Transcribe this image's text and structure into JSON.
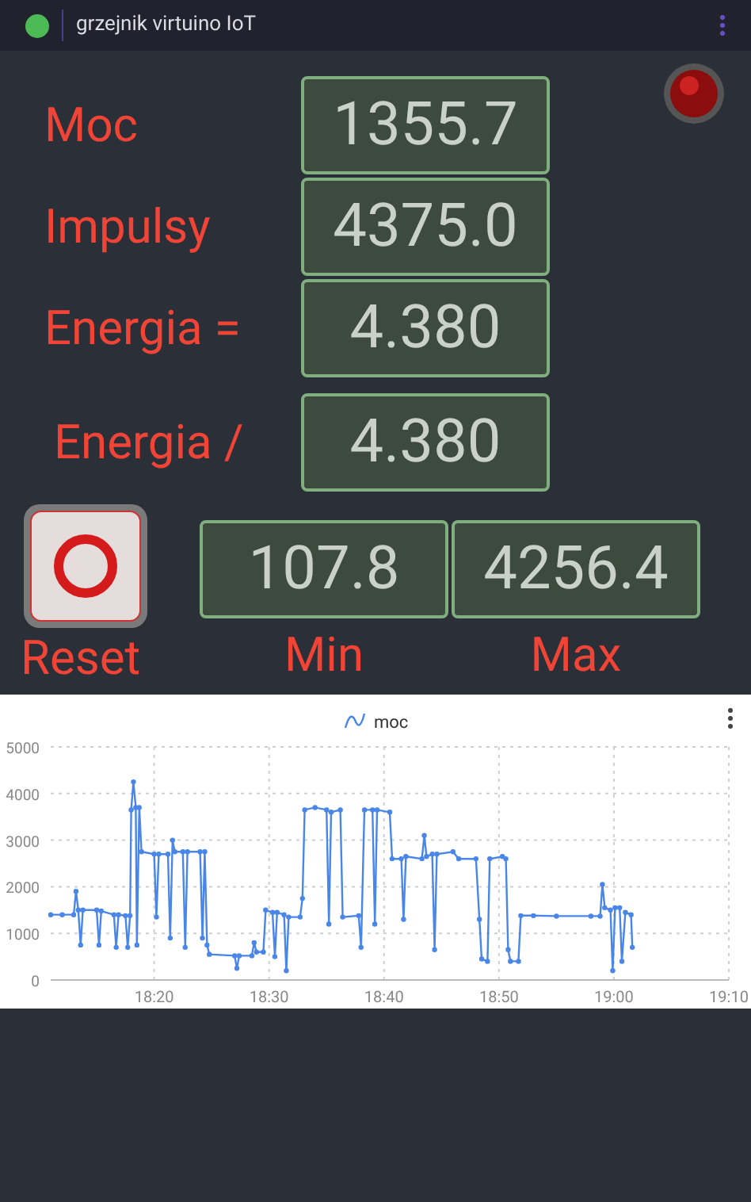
{
  "header": {
    "title": "grzejnik virtuino IoT"
  },
  "readings": [
    {
      "label": "Moc",
      "value": "1355.7"
    },
    {
      "label": "Impulsy",
      "value": "4375.0"
    },
    {
      "label": "Energia =",
      "value": "4.380"
    },
    {
      "label": "Energia /",
      "value": "4.380"
    }
  ],
  "reset": {
    "label": "Reset"
  },
  "extremes": [
    {
      "label": "Min",
      "value": "107.8"
    },
    {
      "label": "Max",
      "value": "4256.4"
    }
  ],
  "chart": {
    "chart_data": {
      "type": "line",
      "x": [
        1091,
        1092,
        1093,
        1093.2,
        1093.4,
        1093.6,
        1093.8,
        1095,
        1095.2,
        1095.4,
        1096.5,
        1096.7,
        1096.9,
        1097.5,
        1097.7,
        1097.9,
        1098,
        1098.2,
        1098.4,
        1098.5,
        1098.7,
        1098.9,
        1100,
        1100.2,
        1100.4,
        1101.2,
        1101.4,
        1101.6,
        1101.8,
        1102.5,
        1102.7,
        1102.9,
        1104,
        1104.2,
        1104.4,
        1104.6,
        1104.8,
        1107,
        1107.2,
        1107.4,
        1108.5,
        1108.7,
        1108.9,
        1109.5,
        1109.7,
        1110.3,
        1110.5,
        1110.7,
        1111.3,
        1111.5,
        1111.7,
        1112.7,
        1112.9,
        1113.1,
        1114,
        1115,
        1115.2,
        1115.4,
        1116.2,
        1116.4,
        1117.8,
        1118,
        1118.3,
        1119,
        1119.2,
        1119.4,
        1120.5,
        1120.7,
        1121.5,
        1121.7,
        1121.9,
        1123.3,
        1123.5,
        1123.7,
        1124.2,
        1124.4,
        1124.6,
        1126,
        1126.5,
        1128,
        1128.3,
        1128.5,
        1129,
        1129.2,
        1130.3,
        1130.6,
        1130.8,
        1131,
        1131.7,
        1131.9,
        1133,
        1135,
        1138,
        1138.8,
        1139,
        1139.2,
        1139.7,
        1139.9,
        1140.1,
        1140.5,
        1140.7,
        1141,
        1141.5,
        1141.6
      ],
      "grid": true,
      "series": [
        {
          "name": "moc",
          "color": "#4a86e8",
          "marker": "o",
          "values": [
            1400,
            1400,
            1400,
            1900,
            1500,
            750,
            1500,
            1500,
            750,
            1480,
            1400,
            700,
            1400,
            1380,
            700,
            1380,
            3650,
            4250,
            3700,
            750,
            3700,
            2750,
            2700,
            1350,
            2700,
            2700,
            900,
            3000,
            2750,
            2750,
            700,
            2750,
            2750,
            900,
            2750,
            750,
            550,
            520,
            250,
            520,
            520,
            800,
            600,
            600,
            1500,
            1450,
            500,
            1450,
            1400,
            200,
            1350,
            1350,
            1750,
            3650,
            3700,
            3650,
            1200,
            3600,
            3650,
            1350,
            1380,
            700,
            3650,
            3650,
            1200,
            3650,
            3600,
            2600,
            2600,
            1300,
            2650,
            2600,
            3100,
            2650,
            2700,
            650,
            2700,
            2750,
            2600,
            2600,
            1300,
            450,
            400,
            2600,
            2650,
            2600,
            650,
            400,
            400,
            1380,
            1380,
            1370,
            1370,
            1370,
            2050,
            1550,
            1500,
            200,
            1550,
            1550,
            400,
            1450,
            1400,
            700
          ]
        }
      ],
      "xlim": [
        1091,
        1150
      ],
      "ylim": [
        0,
        5000
      ],
      "xticks": [
        {
          "value": 1100,
          "label": "18:20"
        },
        {
          "value": 1110,
          "label": "18:30"
        },
        {
          "value": 1120,
          "label": "18:40"
        },
        {
          "value": 1130,
          "label": "18:50"
        },
        {
          "value": 1140,
          "label": "19:00"
        },
        {
          "value": 1150,
          "label": "19:10"
        }
      ],
      "yticks": [
        0,
        1000,
        2000,
        3000,
        4000,
        5000
      ]
    }
  }
}
